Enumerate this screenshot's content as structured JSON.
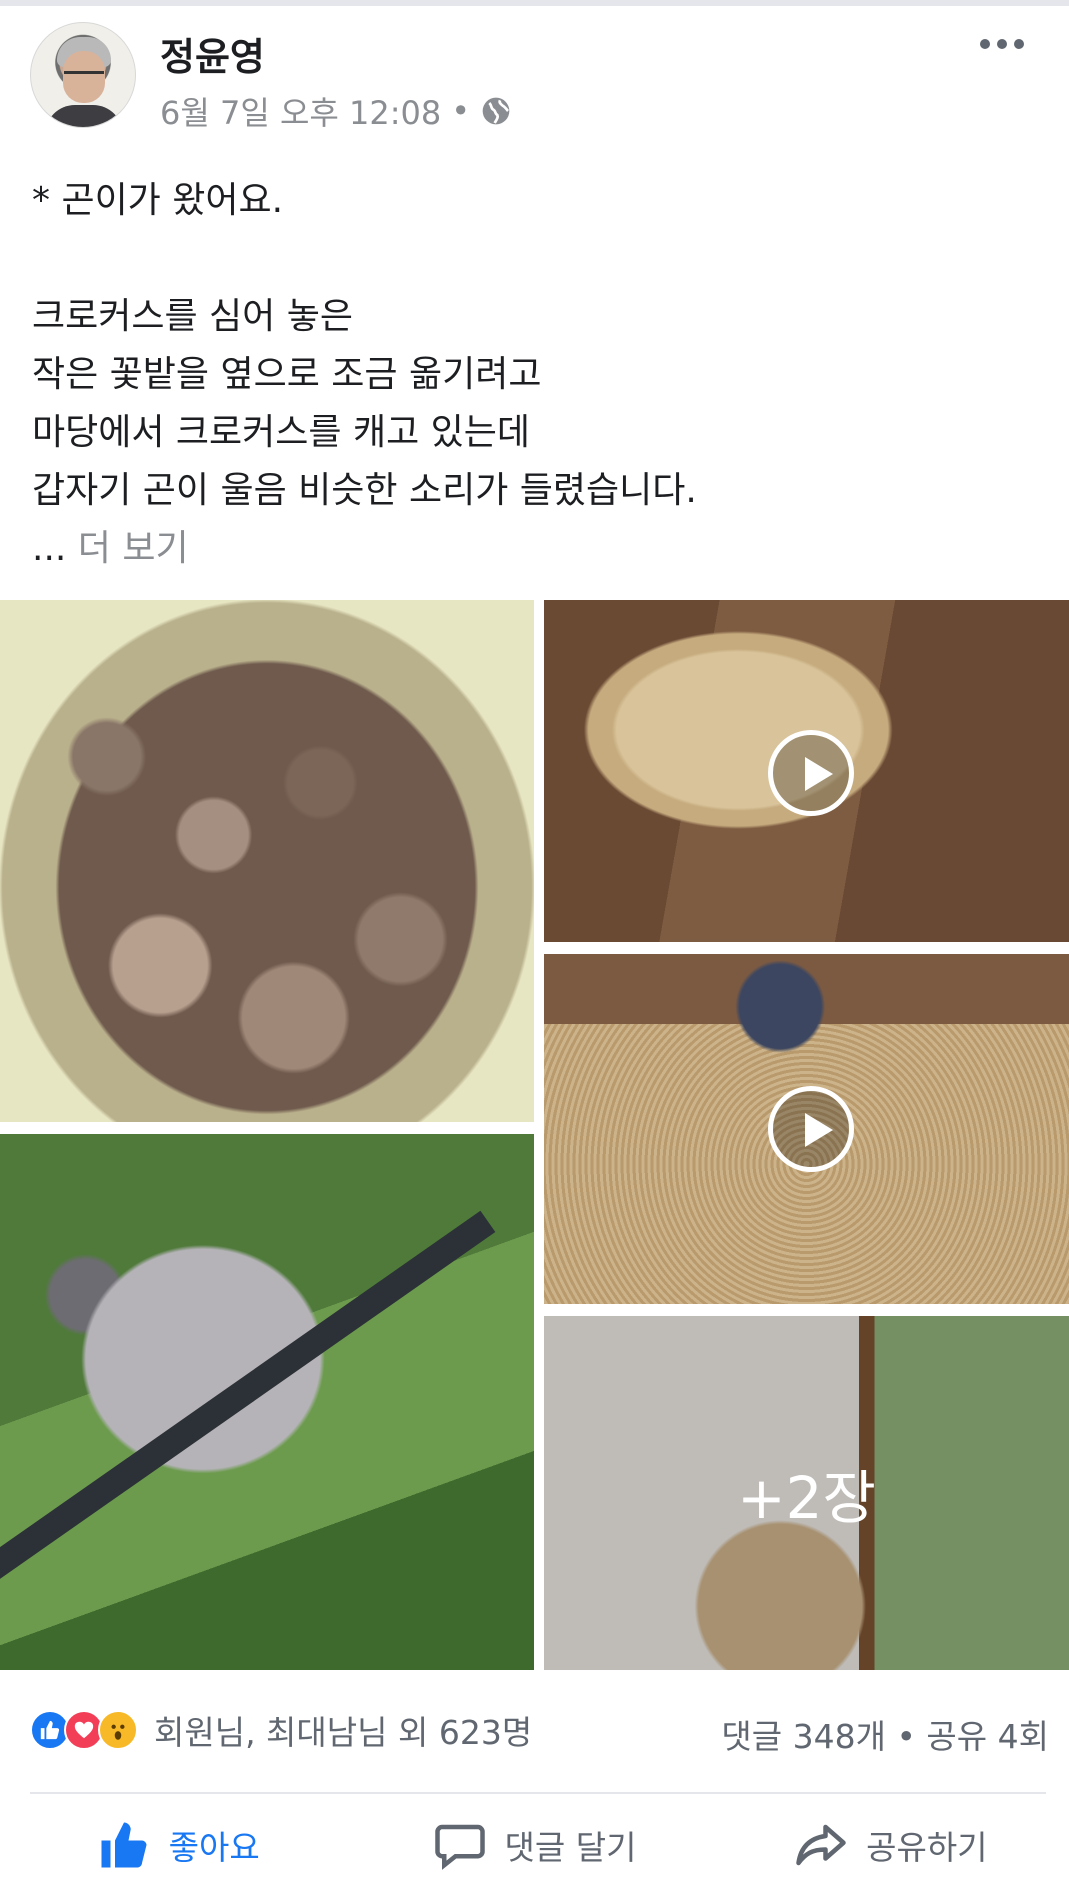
{
  "post": {
    "author": "정윤영",
    "timestamp": "6월 7일 오후 12:08",
    "separator": "•",
    "privacy_icon": "globe-icon",
    "text_lines": [
      "* 곤이가 왔어요.",
      "",
      "크로커스를 심어 놓은",
      "작은 꽃밭을 옆으로 조금 옮기려고",
      "마당에서 크로커스를 캐고 있는데",
      "갑자기 곤이 울음 비슷한 소리가 들렸습니다."
    ],
    "ellipsis": "...",
    "see_more": "더 보기"
  },
  "photos": {
    "more_count": "+2장"
  },
  "reactions": {
    "icons": [
      "like-icon",
      "love-icon",
      "wow-icon"
    ],
    "names": "회원님, 최대남님 외 623명",
    "comments_shares": "댓글 348개 • 공유 4회"
  },
  "actions": {
    "like": "좋아요",
    "comment": "댓글 달기",
    "share": "공유하기"
  },
  "colors": {
    "like_blue": "#1877f2",
    "love_red": "#f33e58",
    "wow_yellow": "#f7b928",
    "secondary_text": "#606770"
  }
}
